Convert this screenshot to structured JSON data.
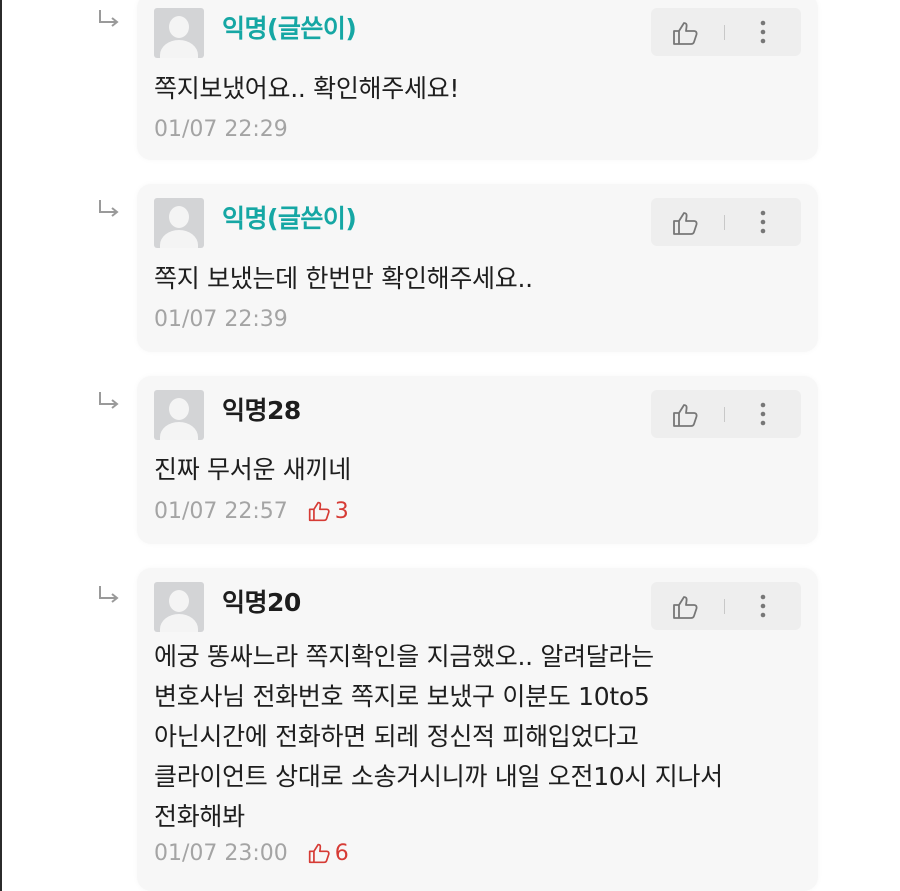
{
  "comments": [
    {
      "author": "익명(글쓴이)",
      "author_type": "op",
      "lines": [
        "쪽지보냈어요.. 확인해주세요!"
      ],
      "timestamp": "01/07 22:29",
      "likes": ""
    },
    {
      "author": "익명(글쓴이)",
      "author_type": "op",
      "lines": [
        "쪽지 보냈는데 한번만 확인해주세요.."
      ],
      "timestamp": "01/07 22:39",
      "likes": ""
    },
    {
      "author": "익명28",
      "author_type": "anon",
      "lines": [
        "진짜 무서운 새끼네"
      ],
      "timestamp": "01/07 22:57",
      "likes": "3"
    },
    {
      "author": "익명20",
      "author_type": "anon",
      "lines": [
        "에궁 똥싸느라 쪽지확인을 지금했오.. 알려달라는",
        "변호사님 전화번호 쪽지로 보냈구 이분도 10to5",
        "아닌시간에 전화하면 되레 정신적 피해입었다고",
        "클라이언트 상대로 소송거시니까 내일 오전10시 지나서",
        "전화해봐"
      ],
      "timestamp": "01/07 23:00",
      "likes": "6"
    }
  ],
  "colors": {
    "op_author": "#16a7a4",
    "anon_author": "#1d1d1d",
    "like_count": "#d63b35",
    "timestamp": "#a4a4a4",
    "card_bg": "#f7f7f7",
    "action_bg": "#eeeeee"
  },
  "icons": {
    "reply": "reply-arrow-icon",
    "avatar": "default-avatar-icon",
    "like": "thumbs-up-icon",
    "more": "more-vertical-icon"
  }
}
